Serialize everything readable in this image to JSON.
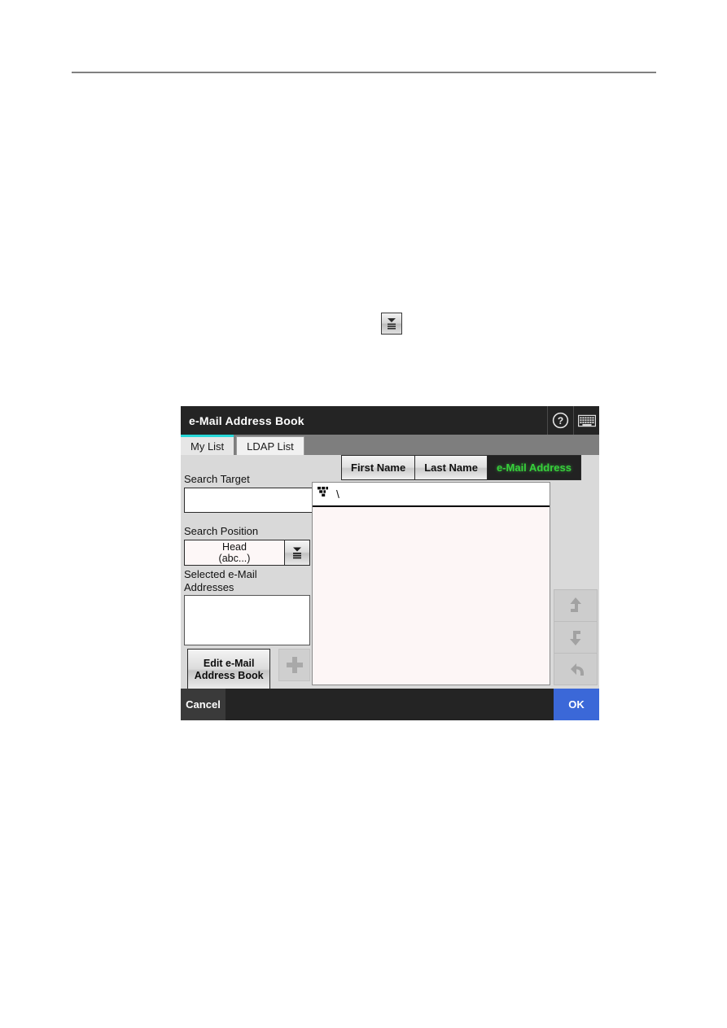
{
  "dialog": {
    "title": "e-Mail Address Book",
    "titlebar_icons": [
      {
        "name": "help-icon",
        "glyph": "?"
      },
      {
        "name": "keyboard-icon",
        "glyph": "keyboard"
      }
    ],
    "tabs": [
      {
        "label": "My List",
        "active": true
      },
      {
        "label": "LDAP List",
        "active": false
      }
    ],
    "left_panel": {
      "search_target_label": "Search Target",
      "search_target_value": "",
      "search_target_placeholder": "",
      "search_button_icon": "search-icon",
      "search_position_label": "Search Position",
      "search_position_value_line1": "Head",
      "search_position_value_line2": "(abc...)",
      "search_position_dropdown_icon": "dropdown-list-icon",
      "selected_addresses_label": "Selected e-Mail\nAddresses",
      "selected_addresses_value": "",
      "edit_button_line1": "Edit e-Mail",
      "edit_button_line2": "Address Book",
      "add_button_icon": "plus-icon",
      "add_button_enabled": false
    },
    "name_tabs": [
      {
        "label": "First Name",
        "selected": false
      },
      {
        "label": "Last Name",
        "selected": false
      },
      {
        "label": "e-Mail Address",
        "selected": true
      }
    ],
    "list_panel": {
      "path_icon": "group-tree-icon",
      "path_text": "\\",
      "rows": []
    },
    "side_actions": [
      {
        "name": "move-up-button",
        "icon": "arrow-up-icon"
      },
      {
        "name": "move-down-button",
        "icon": "arrow-down-icon"
      },
      {
        "name": "undo-button",
        "icon": "undo-arrow-icon"
      }
    ],
    "footer": {
      "cancel_label": "Cancel",
      "ok_label": "OK"
    },
    "colors": {
      "titlebar": "#242424",
      "tab_active_accent": "#28d8d8",
      "selected_tab_text": "#36d13a",
      "ok_button": "#3b68d8",
      "body": "#d9d9d9",
      "list_body": "#fdf6f6"
    }
  },
  "page": {
    "inline_icon_name": "dropdown-list-icon"
  }
}
